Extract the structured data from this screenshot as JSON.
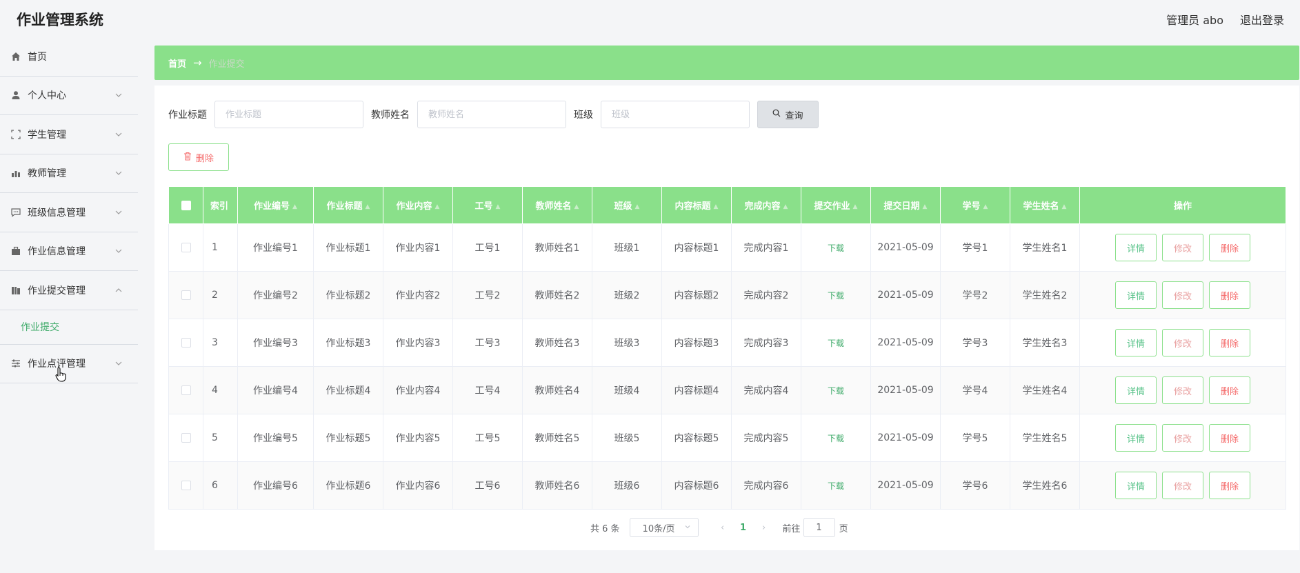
{
  "header": {
    "title": "作业管理系统",
    "user": "管理员 abo",
    "logout": "退出登录"
  },
  "sidebar": {
    "items": [
      {
        "label": "首页",
        "icon": "home-icon"
      },
      {
        "label": "个人中心",
        "icon": "user-icon"
      },
      {
        "label": "学生管理",
        "icon": "frame-icon"
      },
      {
        "label": "教师管理",
        "icon": "chart-icon"
      },
      {
        "label": "班级信息管理",
        "icon": "message-icon"
      },
      {
        "label": "作业信息管理",
        "icon": "briefcase-icon"
      },
      {
        "label": "作业提交管理",
        "icon": "stack-icon"
      },
      {
        "label": "作业点评管理",
        "icon": "sliders-icon"
      }
    ],
    "submenu_active": "作业提交"
  },
  "breadcrumb": {
    "home": "首页",
    "arrow": "→",
    "current": "作业提交"
  },
  "search": {
    "title_label": "作业标题",
    "title_placeholder": "作业标题",
    "teacher_label": "教师姓名",
    "teacher_placeholder": "教师姓名",
    "class_label": "班级",
    "class_placeholder": "班级",
    "query_button": "查询"
  },
  "toolbar": {
    "delete_button": "删除"
  },
  "table": {
    "columns": [
      "索引",
      "作业编号",
      "作业标题",
      "作业内容",
      "工号",
      "教师姓名",
      "班级",
      "内容标题",
      "完成内容",
      "提交作业",
      "提交日期",
      "学号",
      "学生姓名",
      "操作"
    ],
    "rows": [
      [
        "1",
        "作业编号1",
        "作业标题1",
        "作业内容1",
        "工号1",
        "教师姓名1",
        "班级1",
        "内容标题1",
        "完成内容1",
        "下载",
        "2021-05-09",
        "学号1",
        "学生姓名1"
      ],
      [
        "2",
        "作业编号2",
        "作业标题2",
        "作业内容2",
        "工号2",
        "教师姓名2",
        "班级2",
        "内容标题2",
        "完成内容2",
        "下载",
        "2021-05-09",
        "学号2",
        "学生姓名2"
      ],
      [
        "3",
        "作业编号3",
        "作业标题3",
        "作业内容3",
        "工号3",
        "教师姓名3",
        "班级3",
        "内容标题3",
        "完成内容3",
        "下载",
        "2021-05-09",
        "学号3",
        "学生姓名3"
      ],
      [
        "4",
        "作业编号4",
        "作业标题4",
        "作业内容4",
        "工号4",
        "教师姓名4",
        "班级4",
        "内容标题4",
        "完成内容4",
        "下载",
        "2021-05-09",
        "学号4",
        "学生姓名4"
      ],
      [
        "5",
        "作业编号5",
        "作业标题5",
        "作业内容5",
        "工号5",
        "教师姓名5",
        "班级5",
        "内容标题5",
        "完成内容5",
        "下载",
        "2021-05-09",
        "学号5",
        "学生姓名5"
      ],
      [
        "6",
        "作业编号6",
        "作业标题6",
        "作业内容6",
        "工号6",
        "教师姓名6",
        "班级6",
        "内容标题6",
        "完成内容6",
        "下载",
        "2021-05-09",
        "学号6",
        "学生姓名6"
      ]
    ],
    "actions": {
      "detail": "详情",
      "edit": "修改",
      "delete": "删除"
    }
  },
  "pagination": {
    "total": "共 6 条",
    "page_size": "10条/页",
    "current_page": "1",
    "goto_label": "前往",
    "goto_value": "1",
    "page_unit": "页"
  },
  "colors": {
    "accent_green": "#8ae08a",
    "link_green": "#3fab6a",
    "danger": "#f56c6c"
  }
}
